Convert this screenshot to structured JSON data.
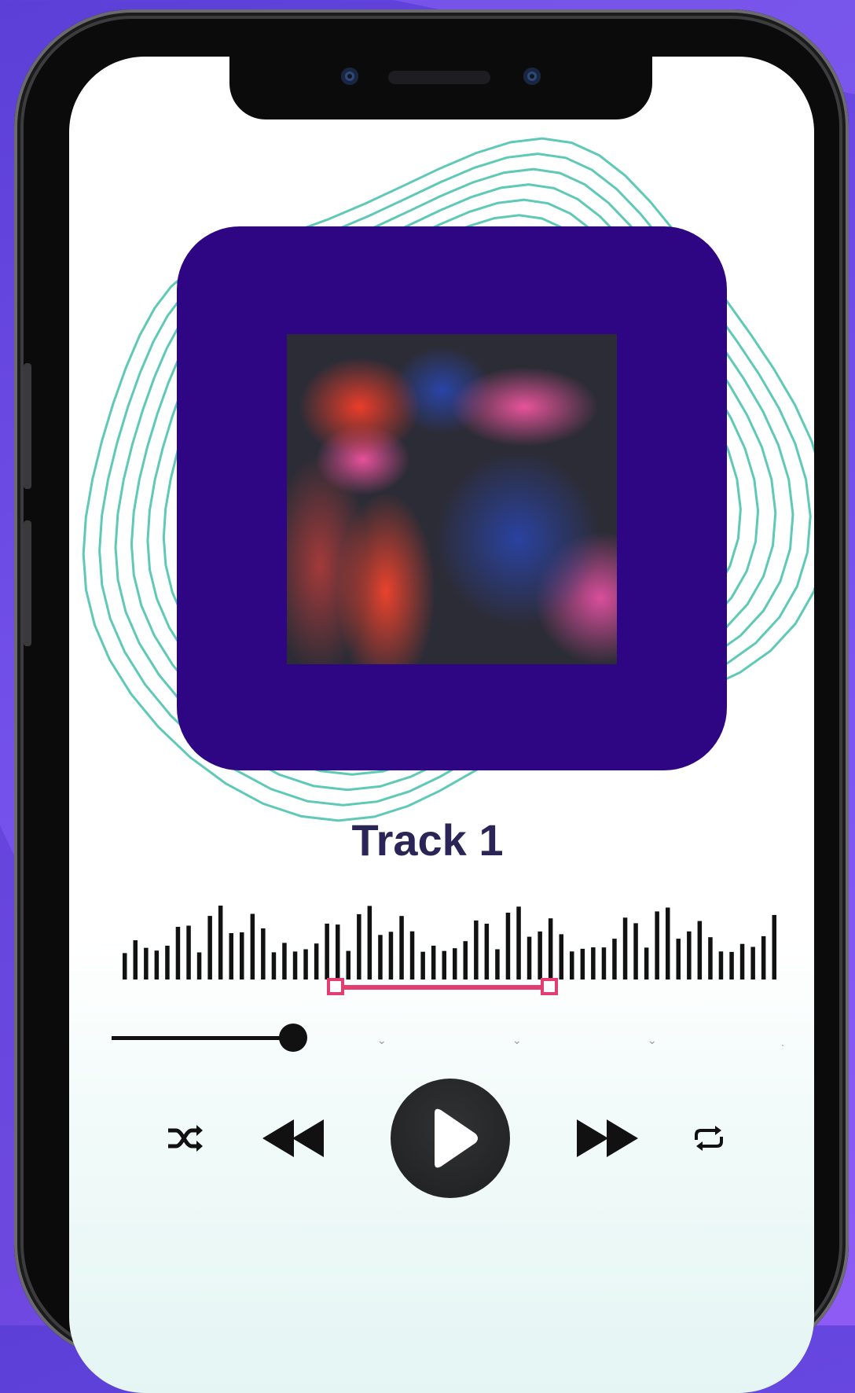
{
  "player": {
    "track_title": "Track 1",
    "progress": 0.27,
    "selection_start": 0.32,
    "selection_end": 0.65
  },
  "controls": {
    "shuffle": "shuffle-icon",
    "rewind": "rewind-icon",
    "play": "play-icon",
    "fast_forward": "fast-forward-icon",
    "repeat": "repeat-icon"
  },
  "colors": {
    "background": "#7a55f0",
    "album_card": "#2e0582",
    "title": "#2a2556",
    "topo_lines": "#5fc9b8",
    "selection": "#e23e6f"
  }
}
